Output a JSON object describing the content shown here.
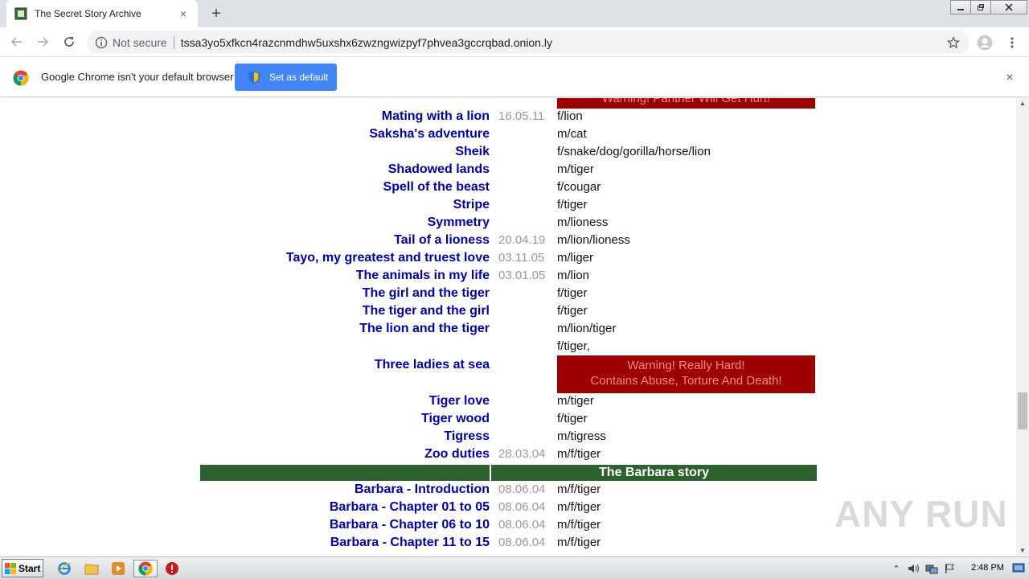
{
  "browser": {
    "tab_title": "The Secret Story Archive",
    "tab_close": "×",
    "new_tab": "+",
    "security_label": "Not secure",
    "url": "tssa3yo5xfkcn4razcnmdhw5uxshx6zwzngwizpyf7phvea3gccrqbad.onion.ly"
  },
  "infobar": {
    "message": "Google Chrome isn't your default browser",
    "button_label": "Set as default",
    "close": "×"
  },
  "content": {
    "top_warning": "Warning! Panther Will Get Hurt!",
    "rows": [
      {
        "title": "Mating with a lion",
        "date": "16.05.11",
        "category": "f/lion"
      },
      {
        "title": "Saksha's adventure",
        "date": "",
        "category": "m/cat"
      },
      {
        "title": "Sheik",
        "date": "",
        "category": "f/snake/dog/gorilla/horse/lion"
      },
      {
        "title": "Shadowed lands",
        "date": "",
        "category": "m/tiger"
      },
      {
        "title": "Spell of the beast",
        "date": "",
        "category": "f/cougar"
      },
      {
        "title": "Stripe",
        "date": "",
        "category": "f/tiger"
      },
      {
        "title": "Symmetry",
        "date": "",
        "category": "m/lioness"
      },
      {
        "title": "Tail of a lioness",
        "date": "20.04.19",
        "category": "m/lion/lioness"
      },
      {
        "title": "Tayo, my greatest and truest love",
        "date": "03.11.05",
        "category": "m/liger"
      },
      {
        "title": "The animals in my life",
        "date": "03.01.05",
        "category": "m/lion"
      },
      {
        "title": "The girl and the tiger",
        "date": "",
        "category": "f/tiger"
      },
      {
        "title": "The tiger and the girl",
        "date": "",
        "category": "f/tiger"
      },
      {
        "title": "The lion and the tiger",
        "date": "",
        "category": "m/lion/tiger"
      }
    ],
    "three_ladies": {
      "title": "Three ladies at sea",
      "category": "f/tiger,",
      "warning_line1": "Warning! Really Hard!",
      "warning_line2": "Contains Abuse, Torture And Death!"
    },
    "rows2": [
      {
        "title": "Tiger love",
        "date": "",
        "category": "m/tiger"
      },
      {
        "title": "Tiger wood",
        "date": "",
        "category": "f/tiger"
      },
      {
        "title": "Tigress",
        "date": "",
        "category": "m/tigress"
      },
      {
        "title": "Zoo duties",
        "date": "28.03.04",
        "category": "m/f/tiger"
      }
    ],
    "section_title": "The Barbara story",
    "barbara_rows": [
      {
        "title": "Barbara - Introduction",
        "date": "08.06.04",
        "category": "m/f/tiger"
      },
      {
        "title": "Barbara - Chapter 01 to 05",
        "date": "08.06.04",
        "category": "m/f/tiger"
      },
      {
        "title": "Barbara - Chapter 06 to 10",
        "date": "08.06.04",
        "category": "m/f/tiger"
      },
      {
        "title": "Barbara - Chapter 11 to 15",
        "date": "08.06.04",
        "category": "m/f/tiger"
      }
    ]
  },
  "watermark": "ANY RUN",
  "taskbar": {
    "start_label": "Start",
    "clock": "2:48 PM"
  },
  "colors": {
    "link": "#0000aa",
    "warning_bg": "#9c0000",
    "warning_text": "#ff8a70",
    "section_bg": "#2d612d",
    "chrome_blue": "#4285f4"
  }
}
